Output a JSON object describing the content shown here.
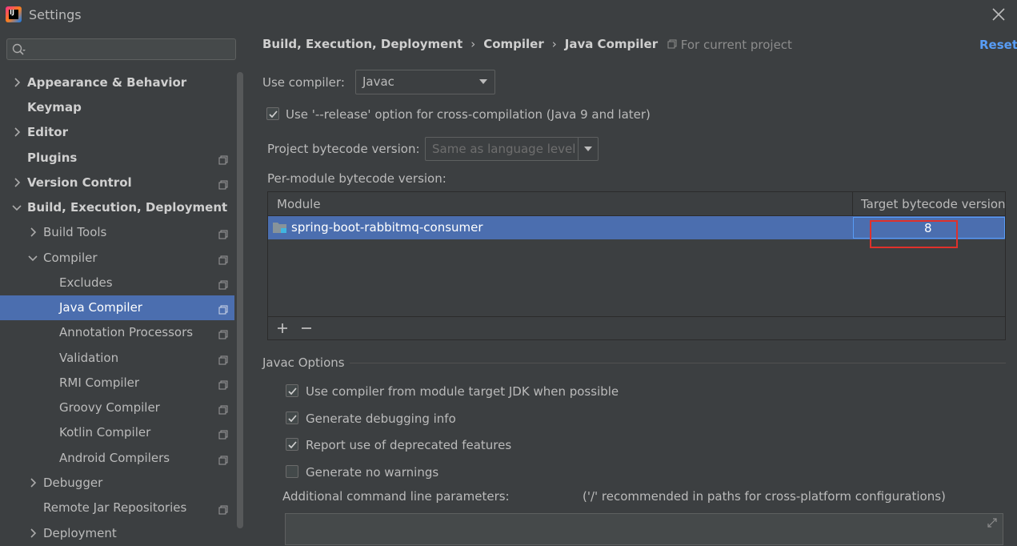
{
  "window": {
    "title": "Settings"
  },
  "search": {
    "placeholder": ""
  },
  "sidebar": {
    "items": [
      {
        "label": "Appearance & Behavior"
      },
      {
        "label": "Keymap"
      },
      {
        "label": "Editor"
      },
      {
        "label": "Plugins"
      },
      {
        "label": "Version Control"
      },
      {
        "label": "Build, Execution, Deployment"
      },
      {
        "label": "Build Tools"
      },
      {
        "label": "Compiler"
      },
      {
        "label": "Excludes"
      },
      {
        "label": "Java Compiler"
      },
      {
        "label": "Annotation Processors"
      },
      {
        "label": "Validation"
      },
      {
        "label": "RMI Compiler"
      },
      {
        "label": "Groovy Compiler"
      },
      {
        "label": "Kotlin Compiler"
      },
      {
        "label": "Android Compilers"
      },
      {
        "label": "Debugger"
      },
      {
        "label": "Remote Jar Repositories"
      },
      {
        "label": "Deployment"
      }
    ]
  },
  "header": {
    "crumbs": [
      "Build, Execution, Deployment",
      "Compiler",
      "Java Compiler"
    ],
    "separator": "›",
    "scope": "For current project",
    "reset_label": "Reset"
  },
  "compiler": {
    "use_compiler_label": "Use compiler:",
    "use_compiler_value": "Javac",
    "release_option_label": "Use '--release' option for cross-compilation (Java 9 and later)",
    "release_option_checked": true,
    "project_bytecode_label": "Project bytecode version:",
    "project_bytecode_value": "Same as language level",
    "per_module_label": "Per-module bytecode version:"
  },
  "module_table": {
    "headers": [
      "Module",
      "Target bytecode version"
    ],
    "rows": [
      {
        "module": "spring-boot-rabbitmq-consumer",
        "version": "8"
      }
    ],
    "add_label": "+",
    "remove_label": "−"
  },
  "javac_options": {
    "title": "Javac Options",
    "options": [
      {
        "label": "Use compiler from module target JDK when possible",
        "checked": true
      },
      {
        "label": "Generate debugging info",
        "checked": true
      },
      {
        "label": "Report use of deprecated features",
        "checked": true
      },
      {
        "label": "Generate no warnings",
        "checked": false
      }
    ],
    "additional_label": "Additional command line parameters:",
    "additional_hint": "('/' recommended in paths for cross-platform configurations)"
  },
  "colors": {
    "background": "#3c3f41",
    "selection": "#4b6eaf",
    "link": "#589df6",
    "highlight": "#e0312b"
  }
}
